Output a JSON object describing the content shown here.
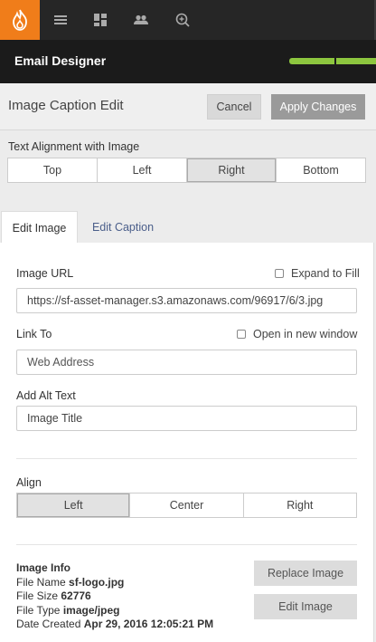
{
  "nav": {
    "icons": [
      "flame-logo-icon",
      "menu-icon",
      "dashboard-icon",
      "users-icon",
      "search-icon"
    ],
    "accent": "#f07d1a"
  },
  "titlebar": {
    "title": "Email Designer",
    "progress_color": "#8dc63f"
  },
  "panel": {
    "title": "Image Caption Edit",
    "cancel_label": "Cancel",
    "apply_label": "Apply Changes"
  },
  "text_alignment": {
    "label": "Text Alignment with Image",
    "options": [
      "Top",
      "Left",
      "Right",
      "Bottom"
    ],
    "selected": "Right"
  },
  "tabs": [
    {
      "label": "Edit Image",
      "active": true
    },
    {
      "label": "Edit Caption",
      "active": false
    }
  ],
  "image_url": {
    "label": "Image URL",
    "value": "https://sf-asset-manager.s3.amazonaws.com/96917/6/3.jpg",
    "expand_label": "Expand to Fill",
    "expand_checked": false
  },
  "link_to": {
    "label": "Link To",
    "placeholder": "Web Address",
    "new_window_label": "Open in new window",
    "new_window_checked": false
  },
  "alt_text": {
    "label": "Add Alt Text",
    "value": "Image Title"
  },
  "align": {
    "label": "Align",
    "options": [
      "Left",
      "Center",
      "Right"
    ],
    "selected": "Left"
  },
  "image_info": {
    "heading": "Image Info",
    "file_name_label": "File Name",
    "file_name": "sf-logo.jpg",
    "file_size_label": "File Size",
    "file_size": "62776",
    "file_type_label": "File Type",
    "file_type": "image/jpeg",
    "date_label": "Date Created",
    "date": "Apr 29, 2016 12:05:21 PM",
    "replace_label": "Replace Image",
    "edit_label": "Edit Image"
  }
}
